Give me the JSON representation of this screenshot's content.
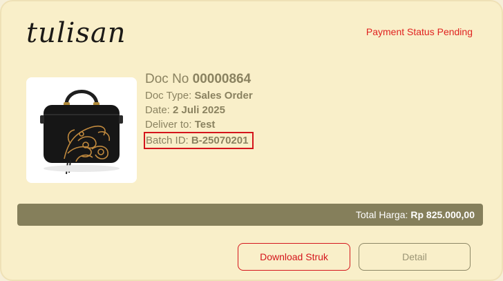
{
  "brand": {
    "name": "tulisan"
  },
  "payment_status": "Payment Status Pending",
  "order": {
    "doc_no_label": "Doc No",
    "doc_no": "00000864",
    "doc_type_label": "Doc Type:",
    "doc_type": "Sales Order",
    "date_label": "Date:",
    "date": "2 Juli 2025",
    "deliver_label": "Deliver to:",
    "deliver_to": "Test",
    "batch_label": "Batch ID:",
    "batch_id": "B-25070201"
  },
  "total": {
    "label": "Total Harga:",
    "amount": "Rp 825.000,00"
  },
  "actions": {
    "download_label": "Download Struk",
    "detail_label": "Detail"
  },
  "colors": {
    "accent_red": "#d4141b",
    "olive": "#857f5b",
    "card_bg": "#f9efc9",
    "text_muted": "#8a8260"
  },
  "icons": {
    "product_image": "black-handbag-with-gold-embroidery"
  }
}
